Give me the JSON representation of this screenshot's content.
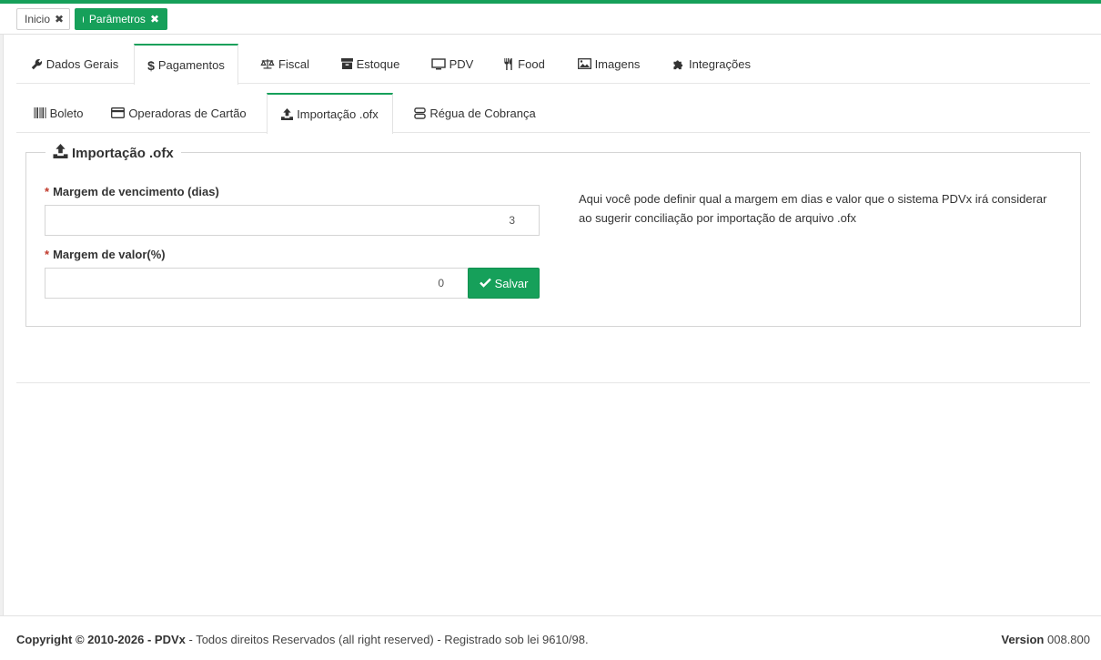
{
  "page_tabs": [
    {
      "label": "Inicio",
      "close": "✖"
    },
    {
      "label": "Parâmetros",
      "close": "✖"
    }
  ],
  "main_tabs": [
    {
      "label": "Dados Gerais",
      "icon": "wrench-icon"
    },
    {
      "label": "Pagamentos",
      "icon": "dollar-icon",
      "active": true
    },
    {
      "label": "Fiscal",
      "icon": "balance-scale-icon"
    },
    {
      "label": "Estoque",
      "icon": "archive-icon"
    },
    {
      "label": "PDV",
      "icon": "monitor-icon"
    },
    {
      "label": "Food",
      "icon": "utensils-icon"
    },
    {
      "label": "Imagens",
      "icon": "image-icon"
    },
    {
      "label": "Integrações",
      "icon": "puzzle-icon"
    }
  ],
  "sub_tabs": [
    {
      "label": "Boleto",
      "icon": "barcode-icon"
    },
    {
      "label": "Operadoras de Cartão",
      "icon": "credit-card-icon"
    },
    {
      "label": "Importação .ofx",
      "icon": "upload-icon",
      "active": true
    },
    {
      "label": "Régua de Cobrança",
      "icon": "server-icon"
    }
  ],
  "section": {
    "title": "Importação .ofx",
    "margem_vencimento": {
      "label": "Margem de vencimento (dias)",
      "required_mark": "*",
      "value": "3"
    },
    "margem_valor": {
      "label": "Margem de valor(%)",
      "required_mark": "*",
      "value": "0"
    },
    "save_label": "Salvar",
    "help_text": "Aqui você pode definir qual a margem em dias e valor que o sistema PDVx irá considerar ao sugerir conciliação por importação de arquivo .ofx"
  },
  "footer": {
    "copyright_bold": "Copyright © 2010-2026 - PDVx",
    "copyright_rest": " - Todos direitos Reservados (all right reserved) - Registrado sob lei 9610/98.",
    "version_label": "Version",
    "version_value": "008.800"
  },
  "colors": {
    "accent": "#16a05a",
    "required": "#c0392b"
  }
}
